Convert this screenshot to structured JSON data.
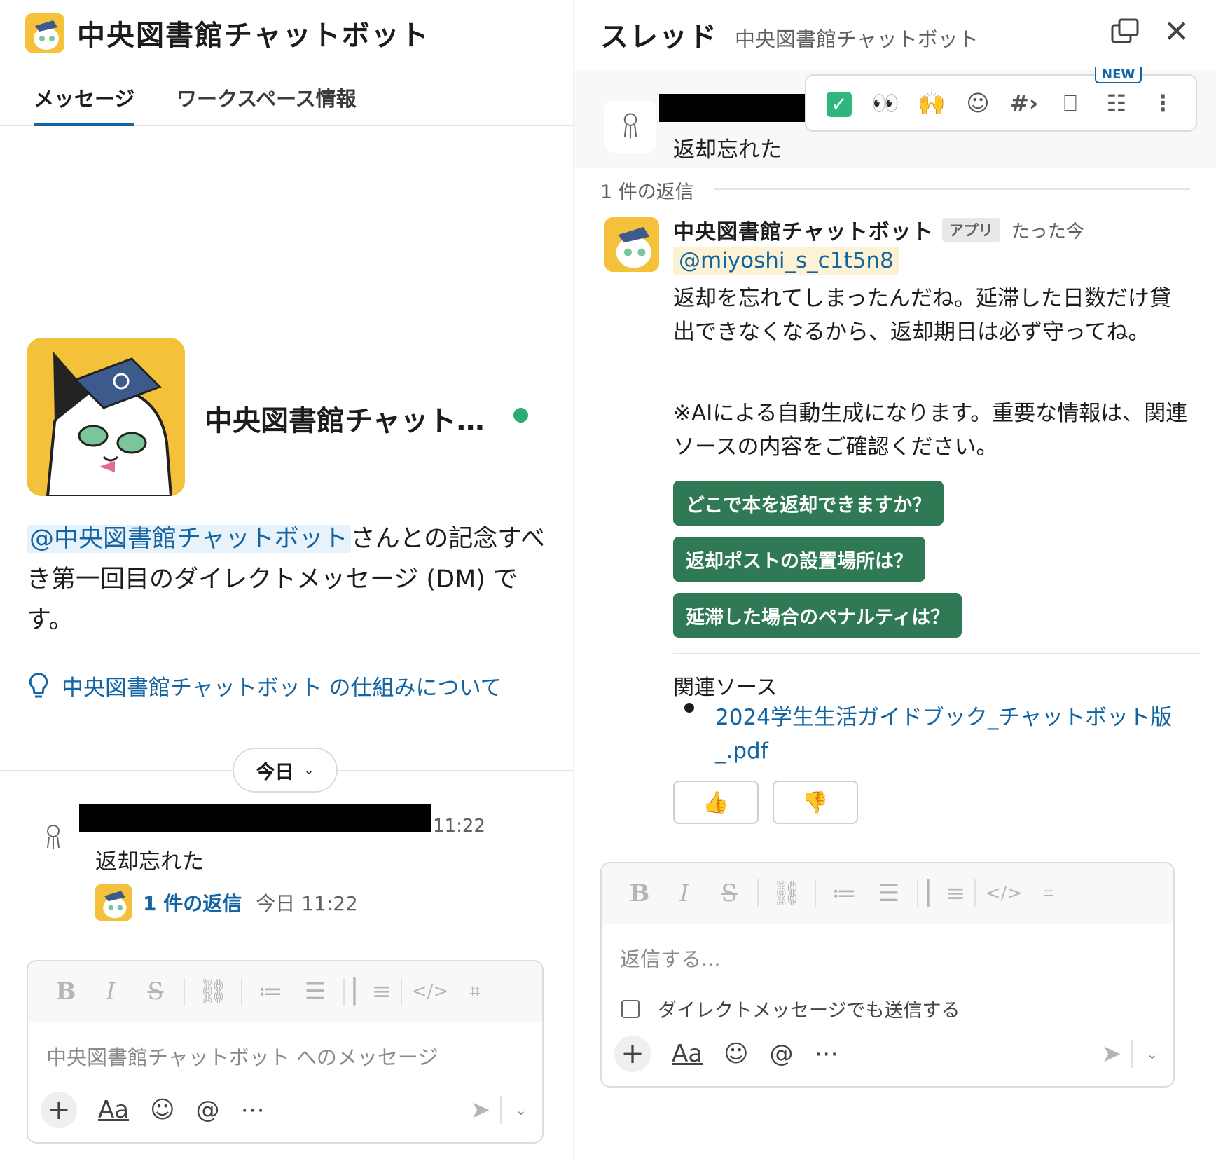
{
  "left": {
    "header_title": "中央図書館チャットボット",
    "tabs": [
      {
        "label": "メッセージ"
      },
      {
        "label": "ワークスペース情報"
      }
    ],
    "profile_name": "中央図書館チャット…",
    "intro_mention": "@中央図書館チャットボット",
    "intro_text": "さんとの記念すべき第一回目のダイレクトメッセージ (DM) です。",
    "how_it_works": "中央図書館チャットボット の仕組みについて",
    "today_label": "今日",
    "message": {
      "time": "11:22",
      "text": "返却忘れた",
      "reply_count": "1 件の返信",
      "reply_time": "今日 11:22"
    },
    "composer_placeholder": "中央図書館チャットボット へのメッセージ"
  },
  "right": {
    "title": "スレッド",
    "subtitle": "中央図書館チャットボット",
    "parent_text": "返却忘れた",
    "new_badge": "NEW",
    "replies_count": "1 件の返信",
    "bot": {
      "name": "中央図書館チャットボット",
      "badge": "アプリ",
      "time": "たった今",
      "mention": "@miyoshi_s_c1t5n8",
      "body": "返却を忘れてしまったんだね。延滞した日数だけ貸出できなくなるから、返却期日は必ず守ってね。",
      "note": "※AIによる自動生成になります。重要な情報は、関連ソースの内容をご確認ください。"
    },
    "suggestions": [
      "どこで本を返却できますか？",
      "返却ポストの設置場所は？",
      "延滞した場合のペナルティは？"
    ],
    "sources_title": "関連ソース",
    "source_link": "2024学生生活ガイドブック_チャットボット版_.pdf",
    "composer_placeholder": "返信する...",
    "also_send_dm": "ダイレクトメッセージでも送信する"
  },
  "icons": {
    "toolbar": [
      "bold-icon",
      "italic-icon",
      "strikethrough-icon",
      "link-icon",
      "ordered-list-icon",
      "bulleted-list-icon",
      "blockquote-icon",
      "code-icon",
      "code-block-icon"
    ],
    "accent": "#1264a3",
    "button_green": "#2f7a55",
    "online": "#2bac76"
  }
}
